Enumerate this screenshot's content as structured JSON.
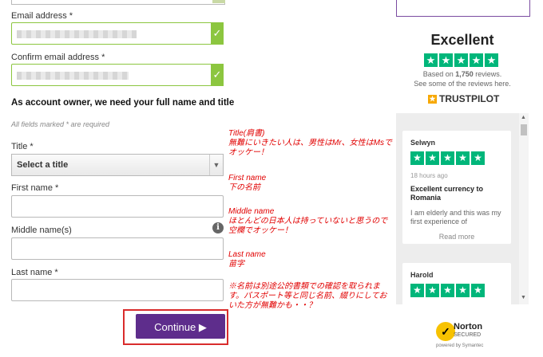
{
  "form": {
    "email_label": "Email address *",
    "confirm_email_label": "Confirm email address *",
    "owner_heading": "As account owner, we need your full name and title",
    "required_note": "All fields marked * are required",
    "title_label": "Title *",
    "title_selected": "Select a title",
    "first_name_label": "First name *",
    "middle_name_label": "Middle name(s)",
    "last_name_label": "Last name *",
    "continue_label": "Continue ▶"
  },
  "annotations": [
    "Title(肩書)",
    "無難にいきたい人は、男性はMr、女性はMsで",
    "オッケー！",
    "First name",
    "下の名前",
    "Middle name",
    "ほとんどの日本人は持っていないと思うので",
    "空欄でオッケー！",
    "Last name",
    "苗字",
    "※名前は別途公的書類での確認を取られま",
    "す。パスポート等と同じ名前、綴りにしてお",
    "いた方が無難かも・・？"
  ],
  "trustpilot": {
    "rating_word": "Excellent",
    "based_prefix": "Based on ",
    "review_count": "1,750",
    "based_suffix": " reviews.",
    "see_some": "See some of the reviews here.",
    "brand": "TRUSTPILOT",
    "reviews": [
      {
        "name": "Selwyn",
        "time": "18 hours ago",
        "title": "Excellent currency to Romania",
        "text": "I am elderly and this was my first experience of",
        "more": "Read more"
      },
      {
        "name": "Harold"
      }
    ]
  },
  "norton": {
    "brand": "Norton",
    "secured": "SECURED",
    "powered": "powered by Symantec"
  },
  "colors": {
    "accent": "#5e2d8c",
    "valid": "#8cc63f",
    "trustpilot_green": "#00b67a",
    "annotation": "#e10000"
  }
}
